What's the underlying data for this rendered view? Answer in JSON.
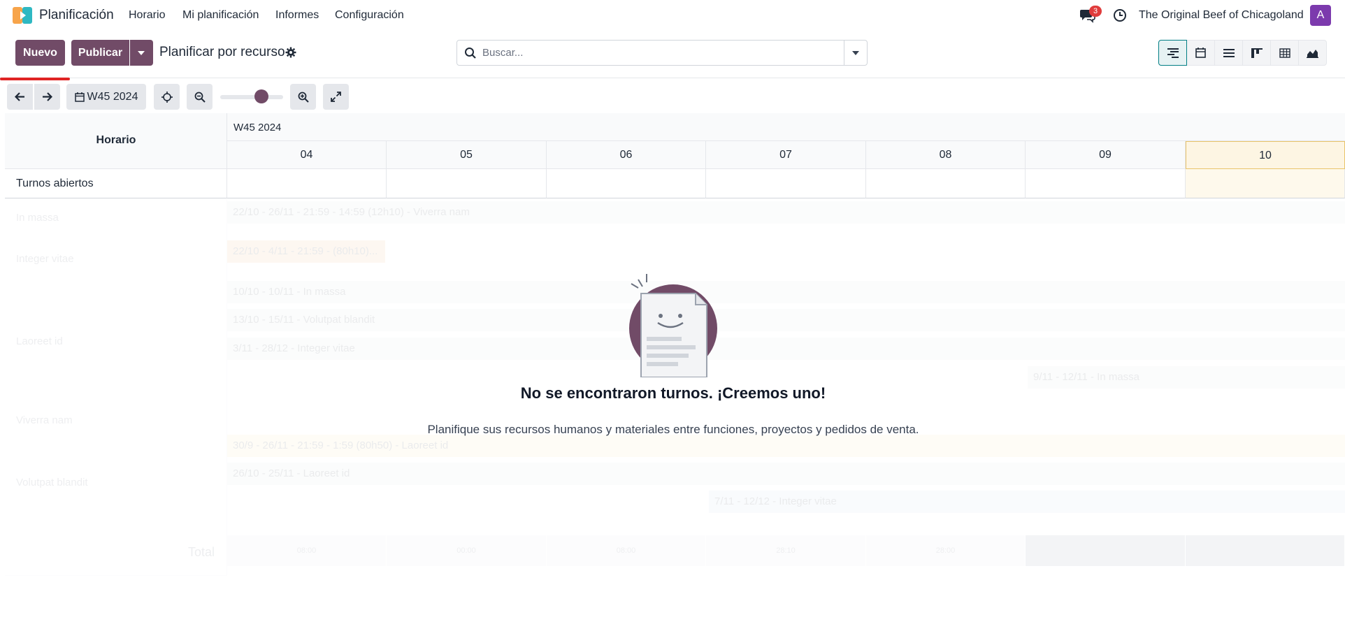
{
  "topnav": {
    "app_name": "Planificación",
    "menu": [
      "Horario",
      "Mi planificación",
      "Informes",
      "Configuración"
    ],
    "messages_badge": "3",
    "company": "The Original Beef of Chicagoland",
    "avatar_letter": "A"
  },
  "controlpanel": {
    "new_label": "Nuevo",
    "publish_label": "Publicar",
    "view_title": "Planificar por recurso",
    "search_placeholder": "Buscar...",
    "views": [
      "gantt",
      "calendar",
      "list",
      "kanban",
      "pivot",
      "graph"
    ],
    "active_view": "gantt"
  },
  "toolbar": {
    "period_label": "W45 2024",
    "zoom_level": 0.65
  },
  "gantt": {
    "header_label": "Horario",
    "week_label": "W45 2024",
    "days": [
      "04",
      "05",
      "06",
      "07",
      "08",
      "09",
      "10"
    ],
    "today_index": 6,
    "open_shifts_label": "Turnos abiertos",
    "resources": [
      "In massa",
      "Integer vitae",
      "Laoreet id",
      "Viverra nam",
      "Volutpat blandit"
    ],
    "pills": [
      "22/10 - 26/11 - 21:59 - 14:59 (12h10) - Viverra nam",
      "22/10 - 4/11 - 21:59 - (80h10)...",
      "10/10 - 10/11 - In massa",
      "13/10 - 15/11 - Volutpat blandit",
      "3/11 - 28/12 - Integer vitae",
      "9/11 - 12/11 - In massa",
      "30/9 - 26/11 - 21:59 - 1:59 (80h50) - Laoreet id",
      "26/10 - 25/11 - Laoreet id",
      "7/11 - 12/12 - Integer vitae"
    ],
    "total_label": "Total",
    "totals": [
      "08:00",
      "00:00",
      "08:00",
      "28:10",
      "28:00",
      "",
      ""
    ]
  },
  "empty_state": {
    "title": "No se encontraron turnos. ¡Creemos uno!",
    "description": "Planifique sus recursos humanos y materiales entre funciones, proyectos y pedidos de venta."
  },
  "colors": {
    "primary": "#714b67",
    "accent": "#017e84",
    "today": "#fdf5e3",
    "badge": "#e03c3c",
    "avatar": "#7c3aad"
  }
}
